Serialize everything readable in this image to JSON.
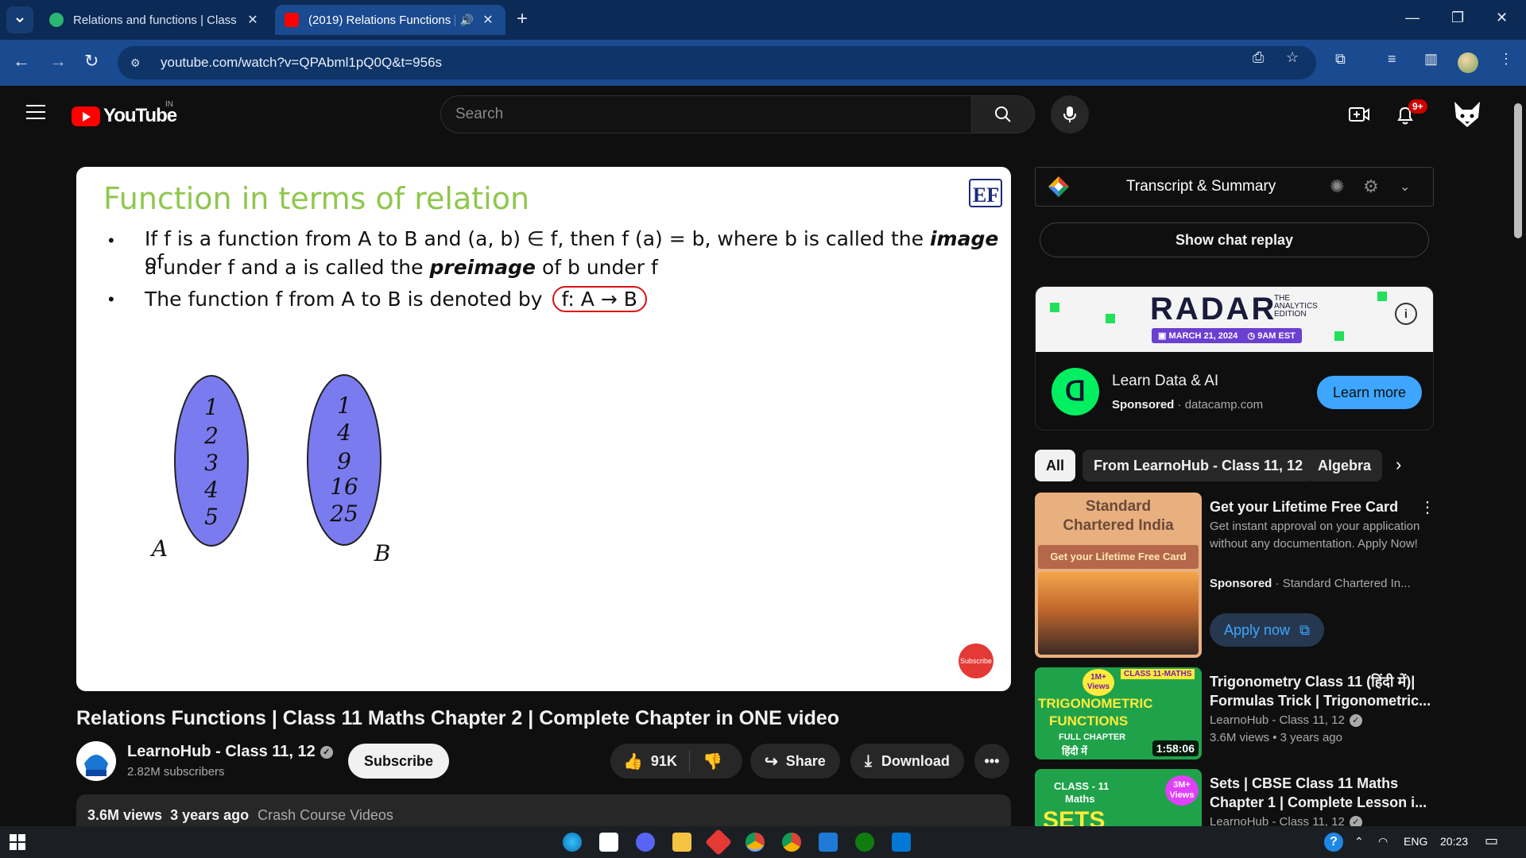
{
  "browser": {
    "tabs": [
      {
        "title": "Relations and functions | Class 1",
        "active": false
      },
      {
        "title": "(2019) Relations Functions |",
        "active": true
      }
    ],
    "url": "youtube.com/watch?v=QPAbml1pQ0Q&t=956s"
  },
  "header": {
    "logo_text": "YouTube",
    "country_code": "IN",
    "search_placeholder": "Search",
    "notification_count": "9+"
  },
  "slide": {
    "title": "Function in terms of relation",
    "line1_a": "If f is a function from A to B and (a, b) ∈ f, then f (a) = b, where b is called the ",
    "line1_image": "image",
    "line1_b": " of",
    "line2_a": "a under f and a is called the ",
    "line2_preimage": "preimage",
    "line2_b": " of b under f",
    "line3": "The function f from A to B is denoted by ",
    "line3_boxed": "f: A → B",
    "set_a_label": "A",
    "set_b_label": "B",
    "set_a_items": [
      "1",
      "2",
      "3",
      "4",
      "5"
    ],
    "set_b_items": [
      "1",
      "4",
      "9",
      "16",
      "25"
    ],
    "logo": "EF",
    "subscribe_watermark": "Subscribe"
  },
  "video": {
    "title": "Relations Functions | Class 11 Maths Chapter 2 | Complete Chapter in ONE video",
    "channel": "LearnoHub - Class 11, 12",
    "subscribers": "2.82M subscribers",
    "subscribe_label": "Subscribe",
    "likes": "91K",
    "share_label": "Share",
    "download_label": "Download",
    "views": "3.6M views",
    "age": "3 years ago",
    "tag": "Crash Course Videos"
  },
  "sidebar": {
    "transcript_title": "Transcript & Summary",
    "chat_replay": "Show chat replay",
    "ad": {
      "banner_brand": "RADAR",
      "banner_sub": [
        "THE",
        "ANALYTICS",
        "EDITION"
      ],
      "banner_date": "MARCH 21, 2024",
      "banner_time": "9AM EST",
      "title": "Learn Data & AI",
      "sponsored": "Sponsored",
      "domain": "datacamp.com",
      "cta": "Learn more"
    },
    "chips": [
      "All",
      "From LearnoHub - Class 11, 12",
      "Algebra"
    ],
    "recs": [
      {
        "title": "Get your Lifetime Free Card",
        "desc": "Get instant approval on your application without any documentation. Apply Now!",
        "sponsored": "Sponsored",
        "advertiser": "Standard Chartered In...",
        "cta": "Apply now",
        "thumb_brand": "Standard Chartered India",
        "thumb_strip": "Get your Lifetime Free Card"
      },
      {
        "title": "Trigonometry Class 11 (हिंदी में)| Formulas Trick | Trigonometric...",
        "channel": "LearnoHub - Class 11, 12",
        "meta": "3.6M views • 3 years ago",
        "duration": "1:58:06",
        "thumb_tag": "CLASS 11-MATHS",
        "thumb_text": [
          "TRIGONOMETRIC",
          "FUNCTIONS",
          "FULL CHAPTER",
          "हिंदी में"
        ],
        "thumb_badge": "1M+ Views"
      },
      {
        "title": "Sets | CBSE Class 11 Maths Chapter 1 | Complete Lesson i...",
        "channel": "LearnoHub - Class 11, 12",
        "thumb_text": [
          "CLASS - 11",
          "Maths",
          "SETS"
        ],
        "thumb_badge": "3M+ Views"
      }
    ]
  },
  "taskbar": {
    "lang": "ENG",
    "time": "20:23"
  }
}
